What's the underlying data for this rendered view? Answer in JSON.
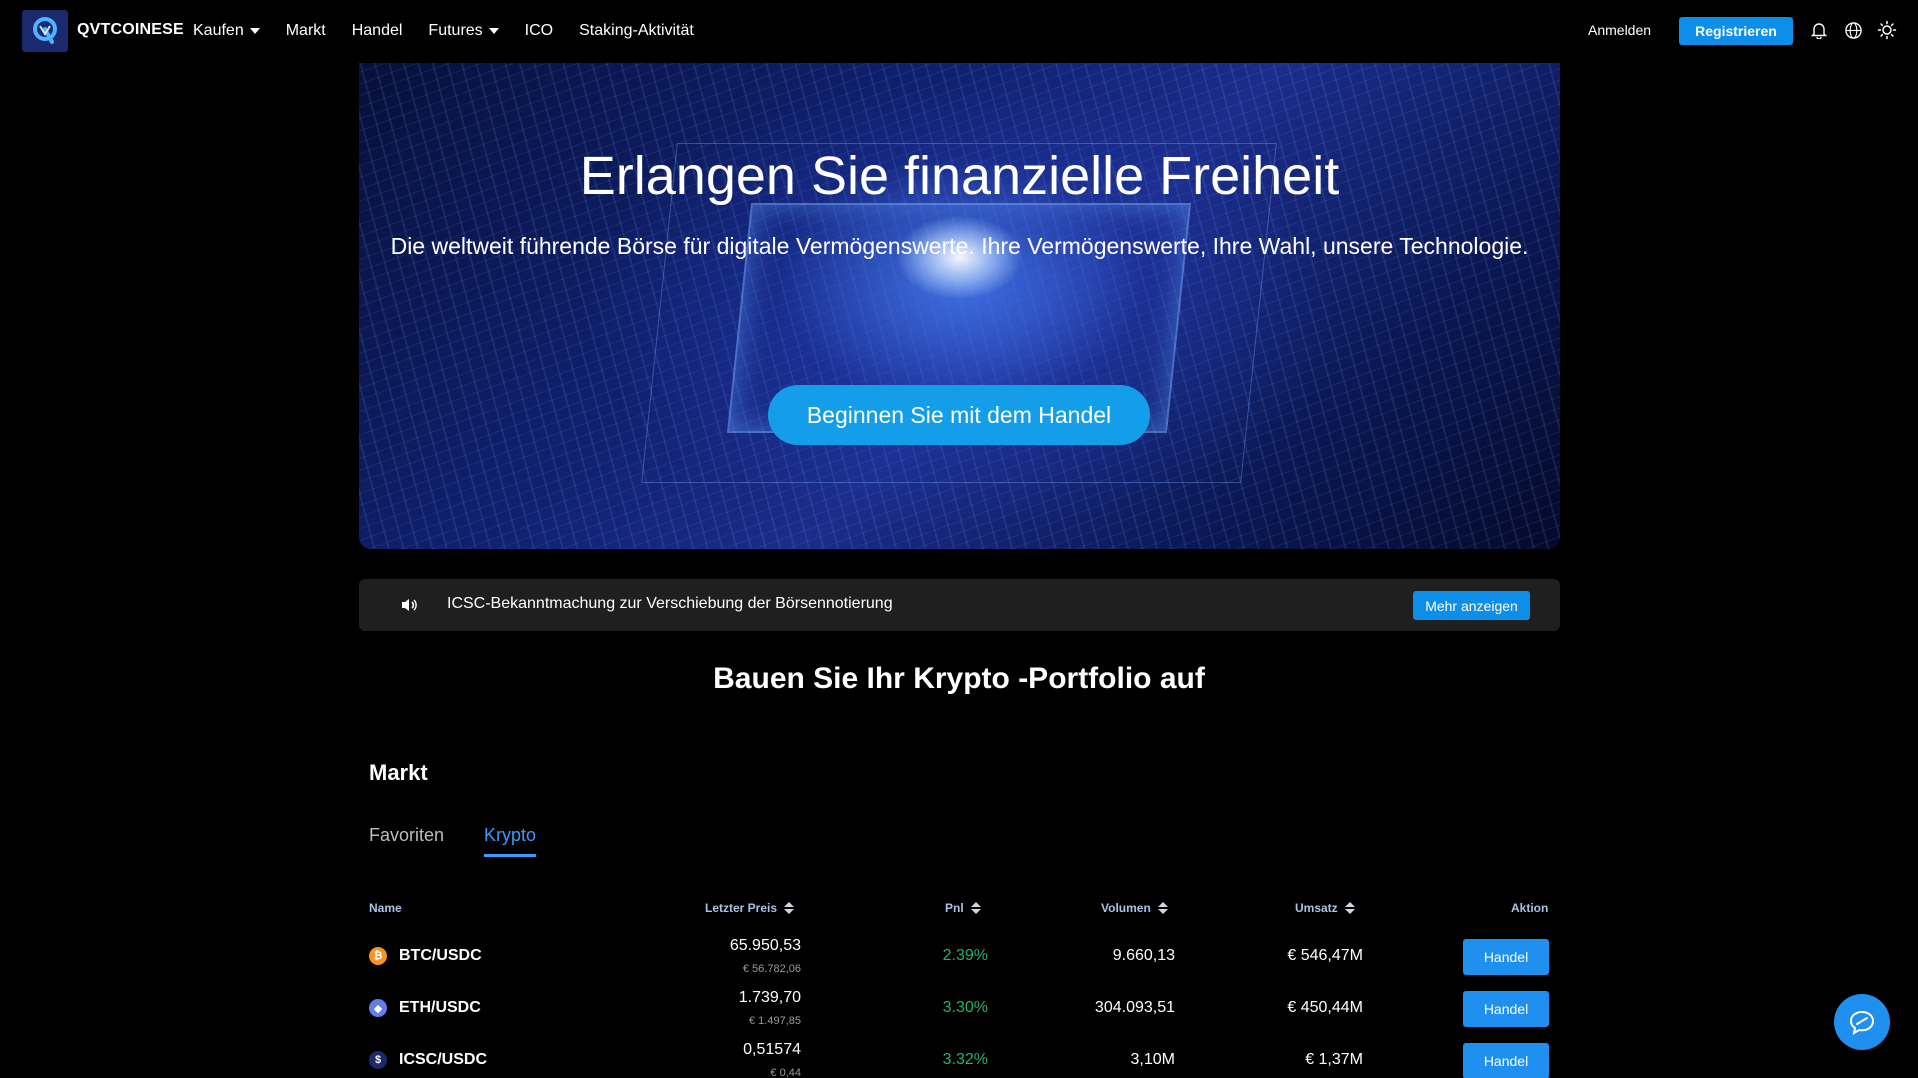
{
  "nav": {
    "brand": "QVTCOINESE",
    "logo_small_text": "QVTCOINESE",
    "items": [
      {
        "label": "Kaufen",
        "dropdown": true
      },
      {
        "label": "Markt",
        "dropdown": false
      },
      {
        "label": "Handel",
        "dropdown": false
      },
      {
        "label": "Futures",
        "dropdown": true
      },
      {
        "label": "ICO",
        "dropdown": false
      },
      {
        "label": "Staking-Aktivität",
        "dropdown": false
      }
    ],
    "login": "Anmelden",
    "register": "Registrieren",
    "icons": [
      "bell-icon",
      "globe-icon",
      "sun-icon"
    ]
  },
  "hero": {
    "title": "Erlangen Sie finanzielle Freiheit",
    "subtitle": "Die weltweit führende Börse für digitale Vermögenswerte. Ihre Vermögenswerte, Ihre Wahl, unsere Technologie.",
    "cta": "Beginnen Sie mit dem Handel"
  },
  "announcement": {
    "icon": "speaker-icon",
    "text": "ICSC-Bekanntmachung zur Verschiebung der Börsennotierung",
    "button": "Mehr anzeigen"
  },
  "section": {
    "title": "Bauen Sie Ihr Krypto -Portfolio auf"
  },
  "market": {
    "title": "Markt",
    "tabs": [
      {
        "label": "Favoriten",
        "active": false
      },
      {
        "label": "Krypto",
        "active": true
      }
    ],
    "columns": {
      "name": "Name",
      "last_price": "Letzter Preis",
      "pnl": "Pnl",
      "volume": "Volumen",
      "turnover": "Umsatz",
      "action": "Aktion"
    },
    "rows": [
      {
        "pair": "BTC/USDC",
        "icon_glyph": "₿",
        "icon_color": "#f7931a",
        "price": "65.950,53",
        "price_eur": "€ 56.782,06",
        "pnl": "2.39%",
        "volume": "9.660,13",
        "turnover": "€ 546,47M",
        "action": "Handel"
      },
      {
        "pair": "ETH/USDC",
        "icon_glyph": "◆",
        "icon_color": "#627eea",
        "price": "1.739,70",
        "price_eur": "€ 1.497,85",
        "pnl": "3.30%",
        "volume": "304.093,51",
        "turnover": "€ 450,44M",
        "action": "Handel"
      },
      {
        "pair": "ICSC/USDC",
        "icon_glyph": "$",
        "icon_color": "#1b2a6b",
        "price": "0,51574",
        "price_eur": "€ 0,44",
        "pnl": "3.32%",
        "volume": "3,10M",
        "turnover": "€ 1,37M",
        "action": "Handel"
      }
    ]
  },
  "chat": {
    "icon": "chat-icon"
  },
  "colors": {
    "accent": "#0d8ee8",
    "positive": "#21b36e",
    "tab_active": "#3b9bff",
    "background": "#000000"
  }
}
